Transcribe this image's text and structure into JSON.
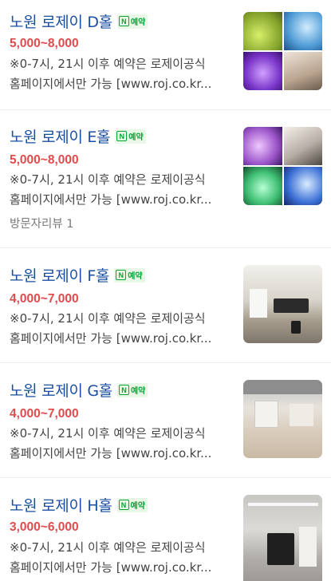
{
  "listings": [
    {
      "title": "노원 로제이 D홀",
      "badge": "예약",
      "price": "5,000~8,000",
      "desc_line1": "※0-7시, 21시 이후 예약은 로제이공식",
      "desc_line2": "홈페이지에서만 가능 [www.roj.co.kr...",
      "review": "",
      "thumb_type": "quad",
      "thumb_colors": [
        "#a7c63a",
        "#5aa8d8",
        "#8a3fd0",
        "#c7b7a8"
      ]
    },
    {
      "title": "노원 로제이 E홀",
      "badge": "예약",
      "price": "5,000~8,000",
      "desc_line1": "※0-7시, 21시 이후 예약은 로제이공식",
      "desc_line2": "홈페이지에서만 가능 [www.roj.co.kr...",
      "review": "방문자리뷰 1",
      "thumb_type": "quad",
      "thumb_colors": [
        "#9b54c8",
        "#b7aea6",
        "#3fbf74",
        "#3b6fd6"
      ]
    },
    {
      "title": "노원 로제이 F홀",
      "badge": "예약",
      "price": "4,000~7,000",
      "desc_line1": "※0-7시, 21시 이후 예약은 로제이공식",
      "desc_line2": "홈페이지에서만 가능 [www.roj.co.kr...",
      "review": "",
      "thumb_type": "photo",
      "thumb_colors": [
        "#d8d4cc",
        "#a89e8f",
        "#2b2b2b"
      ]
    },
    {
      "title": "노원 로제이 G홀",
      "badge": "예약",
      "price": "4,000~7,000",
      "desc_line1": "※0-7시, 21시 이후 예약은 로제이공식",
      "desc_line2": "홈페이지에서만 가능 [www.roj.co.kr...",
      "review": "",
      "thumb_type": "photo",
      "thumb_colors": [
        "#e7e3dc",
        "#c9b9a4",
        "#8d8d8d"
      ]
    },
    {
      "title": "노원 로제이 H홀",
      "badge": "예약",
      "price": "3,000~6,000",
      "desc_line1": "※0-7시, 21시 이후 예약은 로제이공식",
      "desc_line2": "홈페이지에서만 가능 [www.roj.co.kr...",
      "review": "",
      "thumb_type": "photo",
      "thumb_colors": [
        "#dcdad6",
        "#9d9a95",
        "#1f1f1f"
      ]
    }
  ],
  "colors": {
    "title": "#1a4ea0",
    "price": "#e04b4b",
    "badge_green": "#03a636",
    "desc": "#444444",
    "review": "#7a7a7a"
  },
  "icons": {
    "naver_reservation": "naver-n-icon"
  }
}
